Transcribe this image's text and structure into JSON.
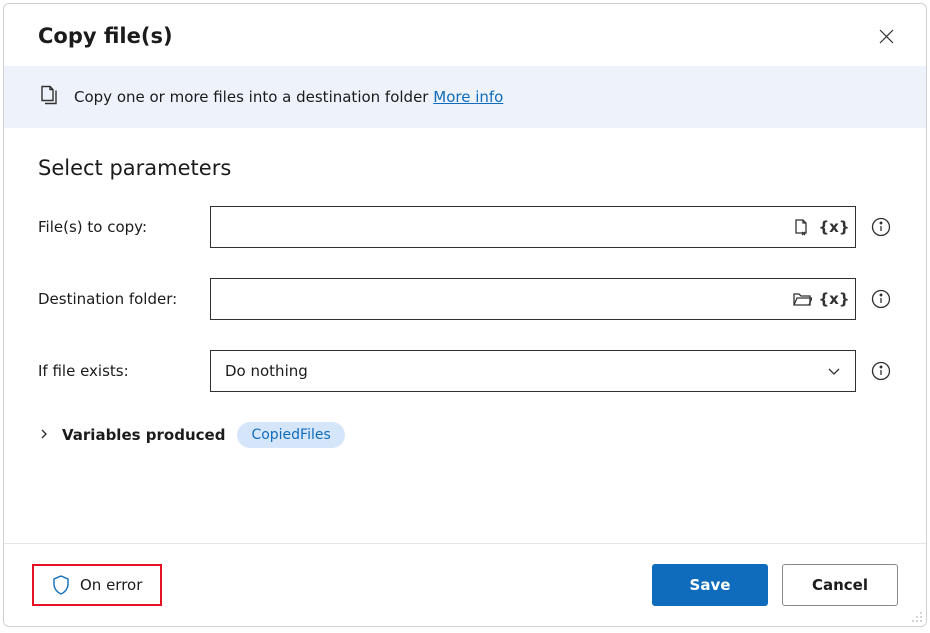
{
  "header": {
    "title": "Copy file(s)"
  },
  "info": {
    "description": "Copy one or more files into a destination folder ",
    "link": "More info"
  },
  "params": {
    "section_title": "Select parameters",
    "files_label": "File(s) to copy:",
    "files_value": "",
    "dest_label": "Destination folder:",
    "dest_value": "",
    "if_exists_label": "If file exists:",
    "if_exists_value": "Do nothing"
  },
  "vars": {
    "label": "Variables produced",
    "pill": "CopiedFiles"
  },
  "footer": {
    "on_error": "On error",
    "save": "Save",
    "cancel": "Cancel"
  }
}
